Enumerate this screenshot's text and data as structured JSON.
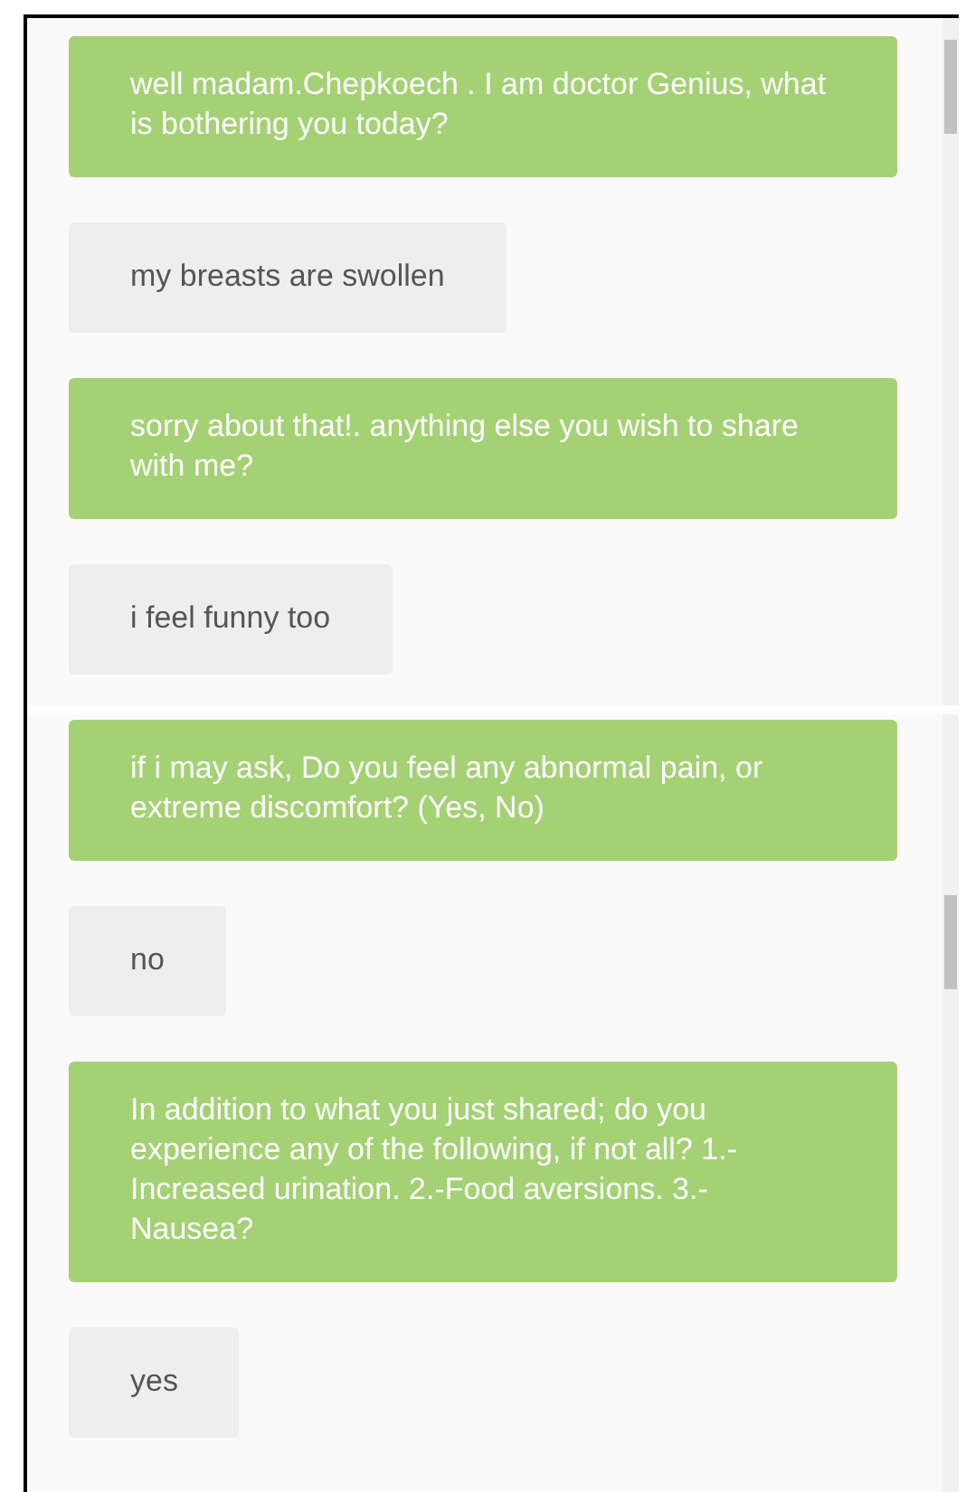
{
  "panels": [
    {
      "messages": [
        {
          "kind": "bot",
          "text": "well madam.Chepkoech . I am doctor Genius, what is bothering you today?"
        },
        {
          "kind": "user",
          "text": "my breasts are swollen"
        },
        {
          "kind": "bot",
          "text": "sorry about that!. anything else you wish to share with me?"
        },
        {
          "kind": "user",
          "text": "i feel funny too"
        }
      ]
    },
    {
      "messages": [
        {
          "kind": "bot",
          "text": "if i may ask, Do you feel any abnormal pain, or extreme discomfort? (Yes, No)"
        },
        {
          "kind": "user",
          "text": "no"
        },
        {
          "kind": "bot",
          "text": "In addition to what you just shared; do you experience any of the following, if not all? 1.- Increased urination. 2.-Food aversions. 3.- Nausea?"
        },
        {
          "kind": "user",
          "text": "yes"
        }
      ]
    }
  ]
}
